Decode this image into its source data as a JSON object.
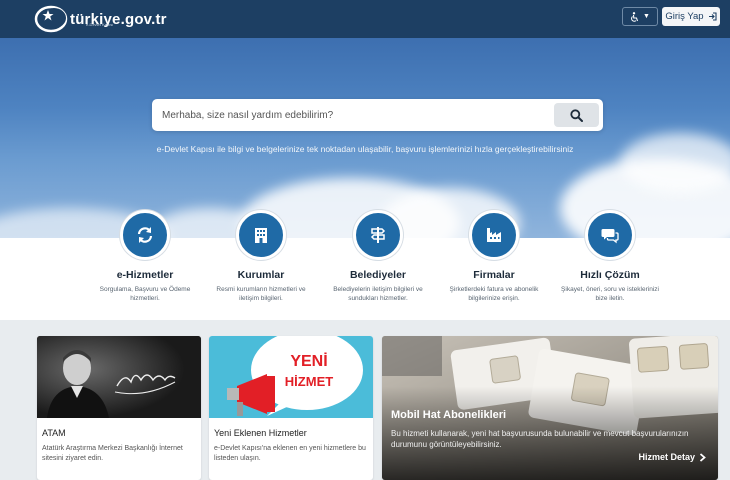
{
  "header": {
    "logo_text": "türkiye.gov.tr",
    "logo_sub": "e-Devlet Kapısı",
    "accessibility_icon": "wheelchair-icon",
    "login_label": "Giriş Yap",
    "login_icon": "sign-in-icon"
  },
  "hero": {
    "search_placeholder": "Merhaba, size nasıl yardım edebilirim?",
    "search_icon": "search-icon",
    "tagline": "e-Devlet Kapısı ile bilgi ve belgelerinize tek noktadan ulaşabilir, başvuru işlemlerinizi hızla gerçekleştirebilirsiniz"
  },
  "services": [
    {
      "title": "e-Hizmetler",
      "desc": "Sorgulama, Başvuru ve Ödeme hizmetleri.",
      "icon": "refresh-icon"
    },
    {
      "title": "Kurumlar",
      "desc": "Resmi kurumların hizmetleri ve iletişim bilgileri.",
      "icon": "building-icon"
    },
    {
      "title": "Belediyeler",
      "desc": "Belediyelerin iletişim bilgileri ve sundukları hizmetler.",
      "icon": "signpost-icon"
    },
    {
      "title": "Firmalar",
      "desc": "Şirketlerdeki fatura ve abonelik bilgilerinize erişin.",
      "icon": "factory-icon"
    },
    {
      "title": "Hızlı Çözüm",
      "desc": "Şikayet, öneri, soru ve isteklerinizi bize iletin.",
      "icon": "chat-icon"
    }
  ],
  "cards": {
    "atam": {
      "title": "ATAM",
      "desc": "Atatürk Araştırma Merkezi Başkanlığı İnternet sitesini ziyaret edin.",
      "signature": "K. Atatürk"
    },
    "yeni": {
      "title": "Yeni Eklenen Hizmetler",
      "desc": "e-Devlet Kapısı'na eklenen en yeni hizmetlere bu listeden ulaşın.",
      "badge_line1": "YENİ",
      "badge_line2": "HİZMET"
    },
    "mobil": {
      "title": "Mobil Hat Abonelikleri",
      "desc": "Bu hizmeti kullanarak, yeni hat başvurusunda bulunabilir ve mevcut başvurularınızın durumunu görüntüleyebilirsiniz.",
      "link": "Hizmet Detay",
      "link_icon": "chevron-right-icon"
    }
  },
  "colors": {
    "navbar": "#1d3f63",
    "accent": "#1f6aa6",
    "badge_red": "#e21f26"
  }
}
